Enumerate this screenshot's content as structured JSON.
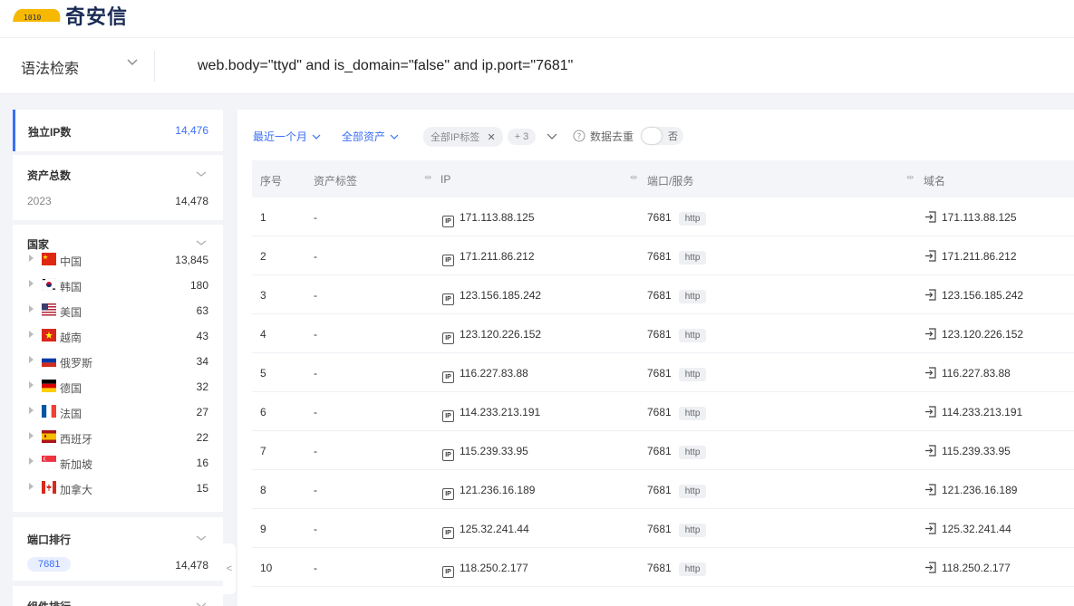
{
  "app": {
    "logo_text": "奇安信"
  },
  "search": {
    "syntax_label": "语法检索",
    "query": "web.body=\"ttyd\" and is_domain=\"false\" and ip.port=\"7681\""
  },
  "sidebar": {
    "unique_ip": {
      "label": "独立IP数",
      "value": "14,476"
    },
    "assets": {
      "title": "资产总数",
      "rows": [
        {
          "label": "2023",
          "value": "14,478"
        }
      ]
    },
    "countries": {
      "title": "国家",
      "items": [
        {
          "name": "中国",
          "count": "13,845",
          "flag": "cn"
        },
        {
          "name": "韩国",
          "count": "180",
          "flag": "kr"
        },
        {
          "name": "美国",
          "count": "63",
          "flag": "us"
        },
        {
          "name": "越南",
          "count": "43",
          "flag": "vn"
        },
        {
          "name": "俄罗斯",
          "count": "34",
          "flag": "ru"
        },
        {
          "name": "德国",
          "count": "32",
          "flag": "de"
        },
        {
          "name": "法国",
          "count": "27",
          "flag": "fr"
        },
        {
          "name": "西班牙",
          "count": "22",
          "flag": "es"
        },
        {
          "name": "新加坡",
          "count": "16",
          "flag": "sg"
        },
        {
          "name": "加拿大",
          "count": "15",
          "flag": "ca"
        }
      ]
    },
    "ports": {
      "title": "端口排行",
      "rows": [
        {
          "label": "7681",
          "value": "14,478"
        }
      ]
    },
    "components": {
      "title": "组件排行"
    },
    "collapse_label": "<"
  },
  "filters": {
    "time": "最近一个月",
    "asset_scope": "全部资产",
    "ip_tag": "全部IP标签",
    "tag_more": "+ 3",
    "dedup_label": "数据去重",
    "dedup_value": "否"
  },
  "table": {
    "columns": [
      "序号",
      "资产标签",
      "IP",
      "端口/服务",
      "域名"
    ],
    "rows": [
      {
        "no": "1",
        "tag": "-",
        "ip": "171.113.88.125",
        "port": "7681",
        "service": "http",
        "domain": "171.113.88.125"
      },
      {
        "no": "2",
        "tag": "-",
        "ip": "171.211.86.212",
        "port": "7681",
        "service": "http",
        "domain": "171.211.86.212"
      },
      {
        "no": "3",
        "tag": "-",
        "ip": "123.156.185.242",
        "port": "7681",
        "service": "http",
        "domain": "123.156.185.242"
      },
      {
        "no": "4",
        "tag": "-",
        "ip": "123.120.226.152",
        "port": "7681",
        "service": "http",
        "domain": "123.120.226.152"
      },
      {
        "no": "5",
        "tag": "-",
        "ip": "116.227.83.88",
        "port": "7681",
        "service": "http",
        "domain": "116.227.83.88"
      },
      {
        "no": "6",
        "tag": "-",
        "ip": "114.233.213.191",
        "port": "7681",
        "service": "http",
        "domain": "114.233.213.191"
      },
      {
        "no": "7",
        "tag": "-",
        "ip": "115.239.33.95",
        "port": "7681",
        "service": "http",
        "domain": "115.239.33.95"
      },
      {
        "no": "8",
        "tag": "-",
        "ip": "121.236.16.189",
        "port": "7681",
        "service": "http",
        "domain": "121.236.16.189"
      },
      {
        "no": "9",
        "tag": "-",
        "ip": "125.32.241.44",
        "port": "7681",
        "service": "http",
        "domain": "125.32.241.44"
      },
      {
        "no": "10",
        "tag": "-",
        "ip": "118.250.2.177",
        "port": "7681",
        "service": "http",
        "domain": "118.250.2.177"
      }
    ]
  },
  "colors": {
    "accent": "#3a6ff7",
    "logo_yellow": "#f6b800",
    "header_bg": "#f3f5f9"
  }
}
